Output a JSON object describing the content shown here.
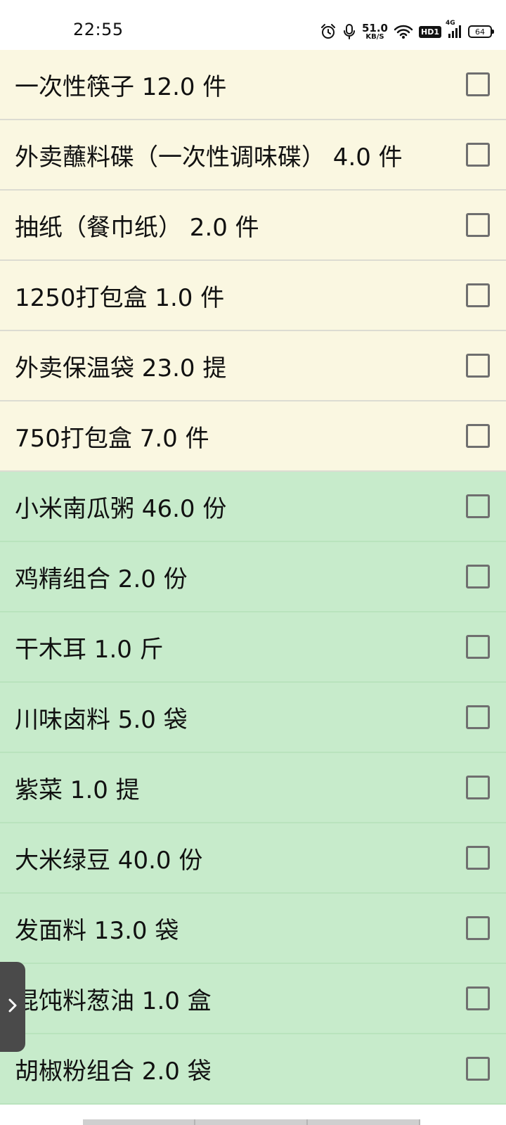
{
  "status_bar": {
    "time": "22:55",
    "net_speed_value": "51.0",
    "net_speed_unit": "KB/S",
    "hd_label": "HD1",
    "signal_label": "4G",
    "battery_level": "64"
  },
  "items": [
    {
      "label": "一次性筷子  12.0 件",
      "color": "yellow",
      "checked": false
    },
    {
      "label": "外卖蘸料碟（一次性调味碟） 4.0 件",
      "color": "yellow",
      "checked": false
    },
    {
      "label": "抽纸（餐巾纸） 2.0 件",
      "color": "yellow",
      "checked": false
    },
    {
      "label": "1250打包盒 1.0 件",
      "color": "yellow",
      "checked": false
    },
    {
      "label": "外卖保温袋  23.0 提",
      "color": "yellow",
      "checked": false
    },
    {
      "label": "750打包盒 7.0 件",
      "color": "yellow",
      "checked": false
    },
    {
      "label": "小米南瓜粥  46.0 份",
      "color": "green",
      "checked": false
    },
    {
      "label": "鸡精组合  2.0 份",
      "color": "green",
      "checked": false
    },
    {
      "label": "干木耳 1.0 斤",
      "color": "green",
      "checked": false
    },
    {
      "label": "川味卤料  5.0 袋",
      "color": "green",
      "checked": false
    },
    {
      "label": "紫菜 1.0 提",
      "color": "green",
      "checked": false
    },
    {
      "label": "大米绿豆  40.0 份",
      "color": "green",
      "checked": false
    },
    {
      "label": "发面料 13.0 袋",
      "color": "green",
      "checked": false
    },
    {
      "label": "混饨料葱油  1.0 盒",
      "color": "green",
      "checked": false
    },
    {
      "label": "胡椒粉组合  2.0 袋",
      "color": "green",
      "checked": false
    }
  ],
  "colors": {
    "row_yellow": "#faf7e1",
    "row_green": "#c7ebcb",
    "checkbox_border": "#6f6f6f",
    "side_handle": "#4a4a4a"
  },
  "icons": {
    "alarm": "alarm-icon",
    "mic": "microphone-icon",
    "wifi": "wifi-icon",
    "signal": "cellular-signal-icon",
    "battery": "battery-icon",
    "expand": "chevron-right-icon"
  }
}
